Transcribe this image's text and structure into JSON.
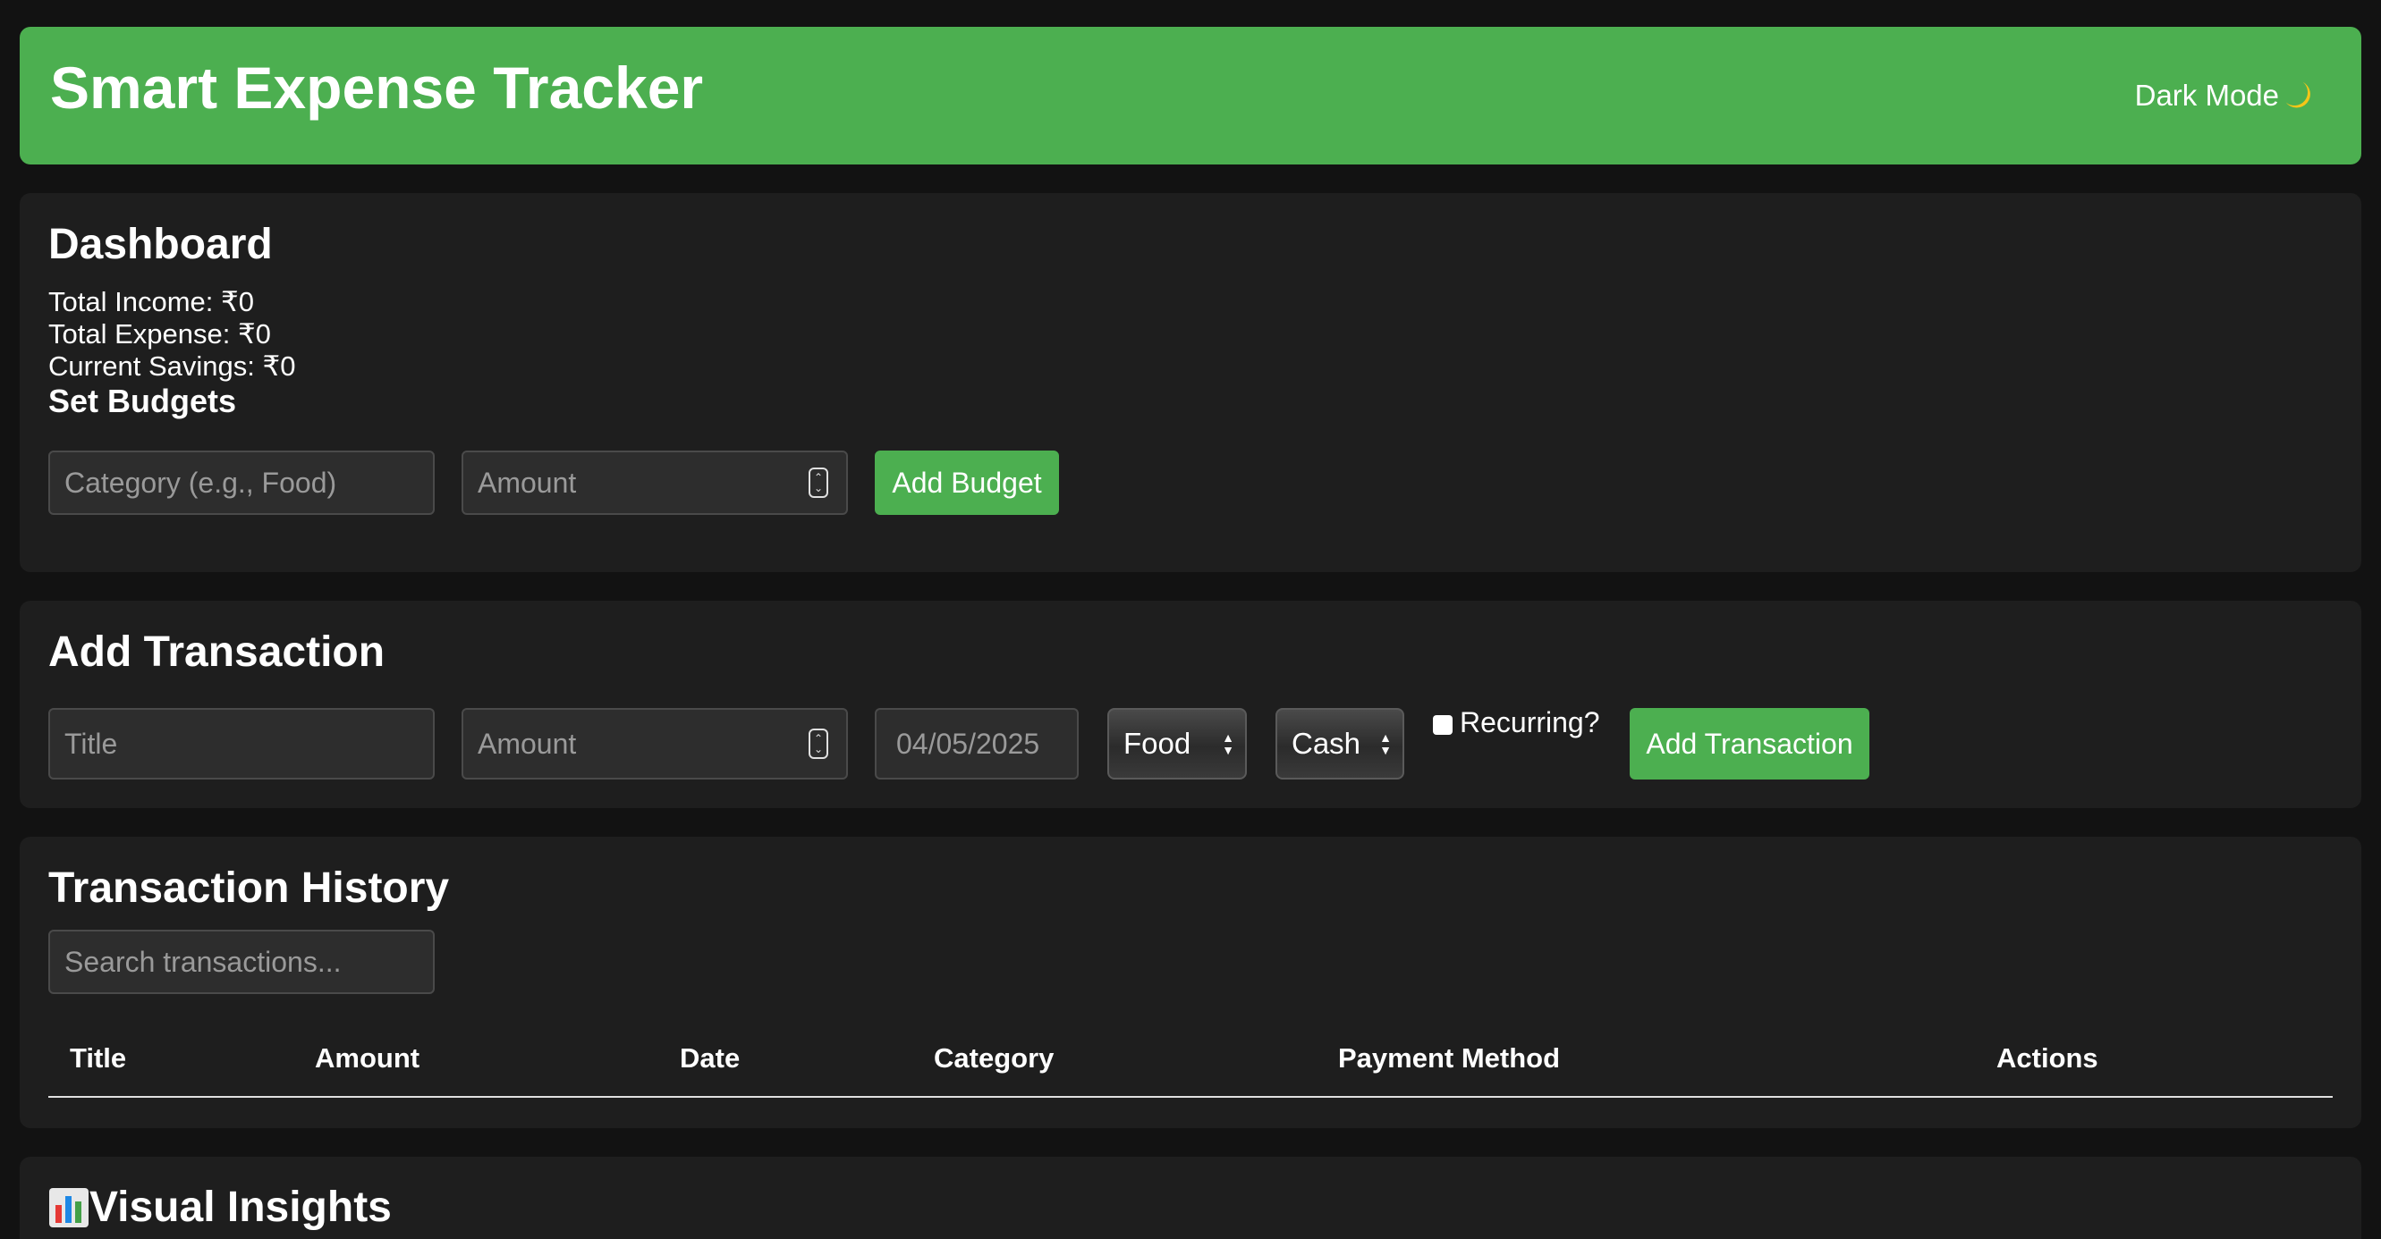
{
  "header": {
    "title": "Smart Expense Tracker",
    "dark_mode_label": "Dark Mode"
  },
  "dashboard": {
    "heading": "Dashboard",
    "total_income": "Total Income: ₹0",
    "total_expense": "Total Expense: ₹0",
    "current_savings": "Current Savings: ₹0",
    "budgets_heading": "Set Budgets",
    "category_placeholder": "Category (e.g., Food)",
    "amount_placeholder": "Amount",
    "add_budget_label": "Add Budget"
  },
  "add_transaction": {
    "heading": "Add Transaction",
    "title_placeholder": "Title",
    "amount_placeholder": "Amount",
    "date_value": "04/05/2025",
    "category_selected": "Food",
    "payment_selected": "Cash",
    "recurring_label": "Recurring?",
    "submit_label": "Add Transaction"
  },
  "history": {
    "heading": "Transaction History",
    "search_placeholder": "Search transactions...",
    "columns": [
      "Title",
      "Amount",
      "Date",
      "Category",
      "Payment Method",
      "Actions"
    ]
  },
  "insights": {
    "heading": "Visual Insights"
  },
  "colors": {
    "accent": "#4caf50",
    "background": "#121212",
    "card": "#1e1e1e"
  }
}
